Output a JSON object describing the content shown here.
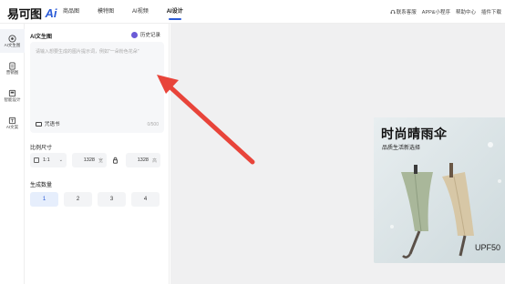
{
  "header": {
    "logo_text": "易可图",
    "logo_ai": "Ai",
    "nav": [
      "商品图",
      "模特图",
      "AI视频",
      "AI设计"
    ],
    "active_nav": "AI设计",
    "right_links": [
      "联系客服",
      "APP&小程序",
      "帮助中心",
      "插件下载"
    ]
  },
  "sidebar": {
    "items": [
      {
        "label": "AI文生图",
        "icon": "image-gen-icon"
      },
      {
        "label": "营销图",
        "icon": "document-icon"
      },
      {
        "label": "智能设计",
        "icon": "design-icon"
      },
      {
        "label": "AI文案",
        "icon": "text-icon"
      }
    ]
  },
  "panel": {
    "title": "AI文生图",
    "history_label": "历史记录",
    "prompt_placeholder": "请输入想要生成的图片提示词，例如\"一朵粉色花朵\"",
    "prompt_button": "咒语书",
    "prompt_count": "0/500",
    "size_title": "比例尺寸",
    "ratio_value": "1:1",
    "width_value": "1328",
    "width_unit": "宽",
    "height_value": "1328",
    "height_unit": "高",
    "count_title": "生成数量",
    "counts": [
      "1",
      "2",
      "3",
      "4"
    ],
    "selected_count": "1"
  },
  "banner": {
    "title": "时尚晴雨伞",
    "subtitle": "品质生活新选择",
    "tag": "UPF50"
  },
  "colors": {
    "accent": "#2b5bd7",
    "arrow": "#e8443a",
    "canvas_bg": "#f0f0f1"
  }
}
